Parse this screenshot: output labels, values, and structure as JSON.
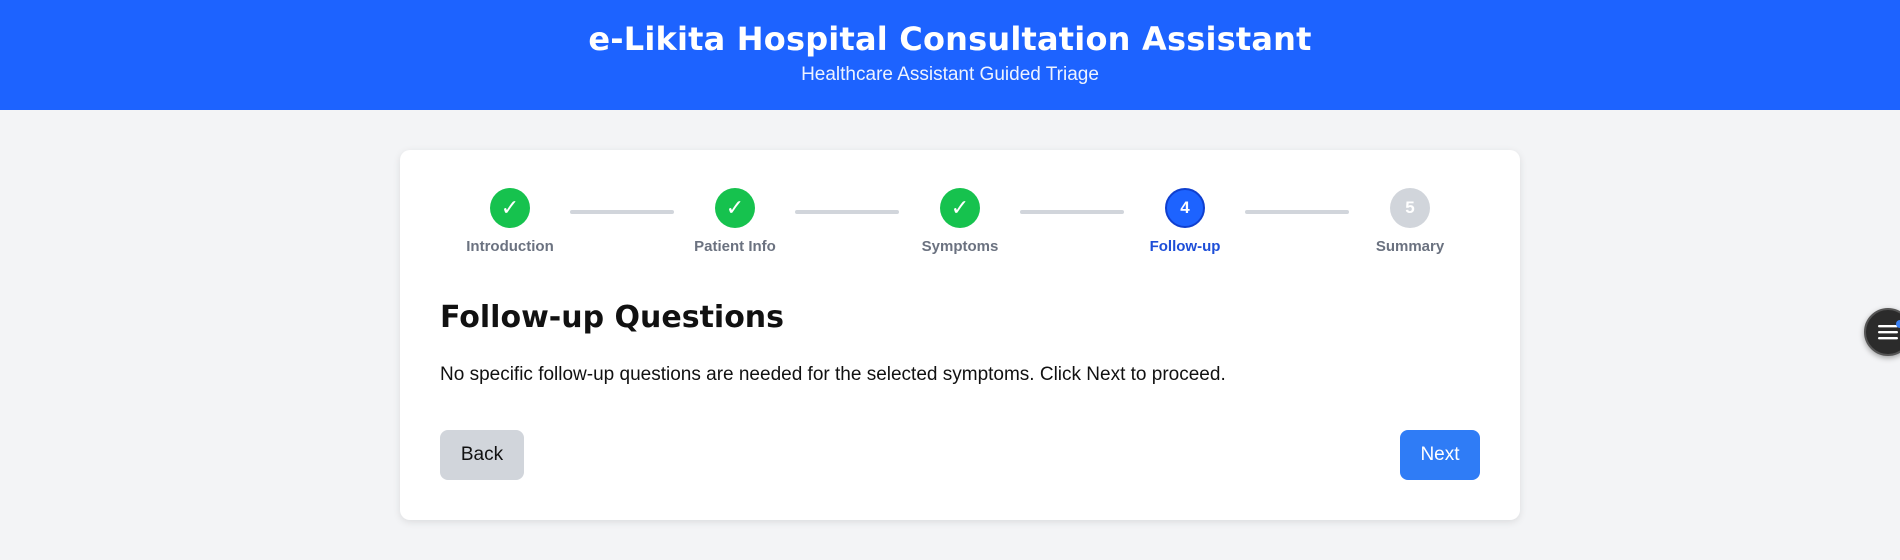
{
  "header": {
    "title": "e-Likita Hospital Consultation Assistant",
    "subtitle": "Healthcare Assistant Guided Triage"
  },
  "stepper": {
    "steps": [
      {
        "label": "Introduction",
        "status": "done",
        "marker": "✓"
      },
      {
        "label": "Patient Info",
        "status": "done",
        "marker": "✓"
      },
      {
        "label": "Symptoms",
        "status": "done",
        "marker": "✓"
      },
      {
        "label": "Follow-up",
        "status": "active",
        "marker": "4"
      },
      {
        "label": "Summary",
        "status": "pending",
        "marker": "5"
      }
    ]
  },
  "main": {
    "heading": "Follow-up Questions",
    "message": "No specific follow-up questions are needed for the selected symptoms. Click Next to proceed.",
    "back_label": "Back",
    "next_label": "Next"
  },
  "fab": {
    "icon": "menu-icon"
  },
  "colors": {
    "header_bg": "#1d63ff",
    "done": "#16c24e",
    "active": "#1d63ff",
    "pending": "#d1d5db",
    "next_button": "#2f7cf6",
    "back_button": "#d1d5db"
  }
}
